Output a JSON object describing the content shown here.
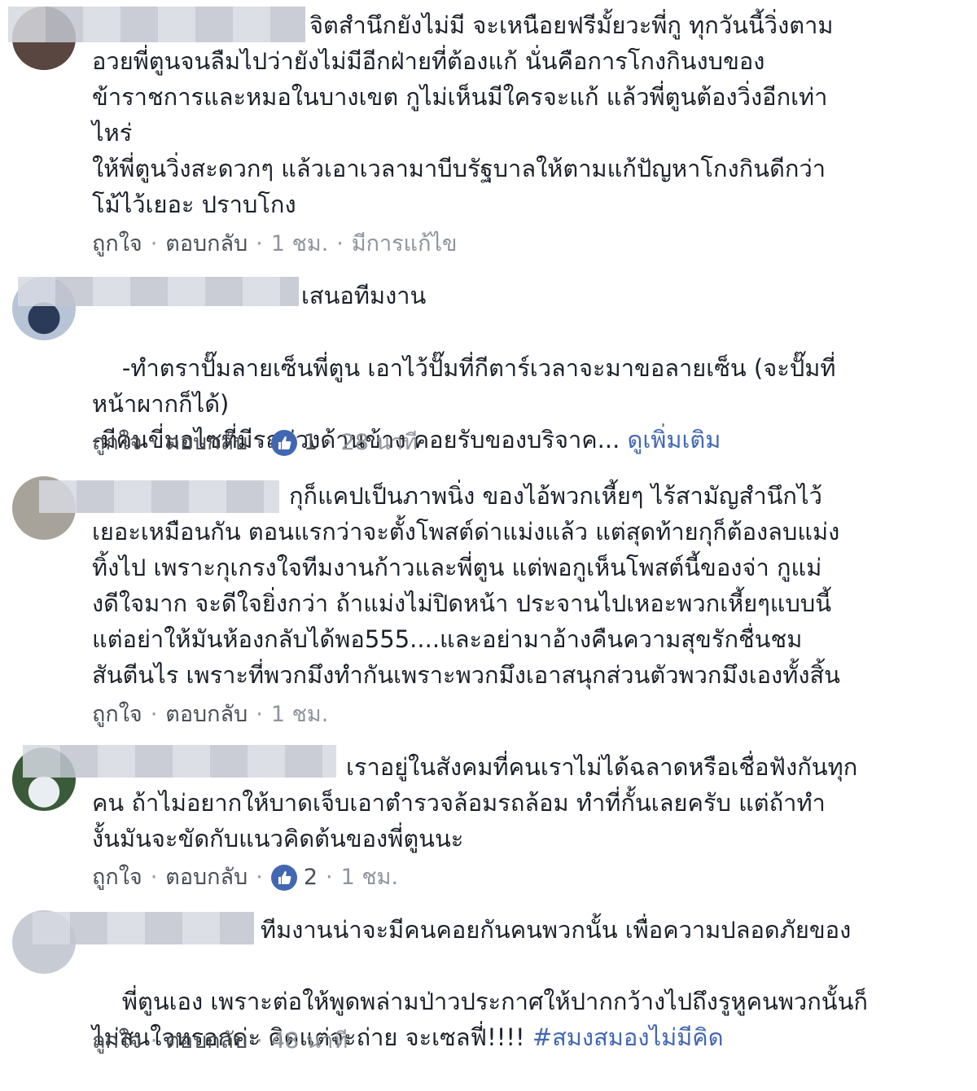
{
  "comments": [
    {
      "first_line": "จิตสำนึกยังไม่มี จะเหนือยฟรีมั้ยวะพี่กู ทุกวันนี้วิ่งตาม",
      "body": "อวยพี่ตูนจนลืมไปว่ายังไม่มีอีกฝ่ายที่ต้องแก้ นั่นคือการโกงกินงบของ\nข้าราชการและหมอในบางเขต กูไม่เห็นมีใครจะแก้ แล้วพี่ตูนต้องวิ่งอีกเท่า\nไหร่\nให้พี่ตูนวิ่งสะดวกๆ แล้วเอาเวลามาบีบรัฐบาลให้ตามแก้ปัญหาโกงกินดีกว่า\nโม้ไว้เยอะ ปราบโกง",
      "like": "ถูกใจ",
      "reply": "ตอบกลับ",
      "reactions": "",
      "time": "1 ชม.",
      "edited": "มีการแก้ไข"
    },
    {
      "first_line": "เสนอทีมงาน",
      "body": "-ทำตราปั๊มลายเซ็นพี่ตูน เอาไว้ปั๊มที่กีตาร์เวลาจะมาขอลายเซ็น (จะปั๊มที่\nหน้าผากก็ได้)\n-มีคนขี่มอไซที่มีรถพ่วงด้านข้าง คอยรับของบริจาค... ",
      "see_more": "ดูเพิ่มเติม",
      "like": "ถูกใจ",
      "reply": "ตอบกลับ",
      "reactions": "1",
      "time": "28 นาที"
    },
    {
      "first_line": "กุก็แคปเป็นภาพนิ่ง ของไอ้พวกเหี้ยๆ ไร้สามัญสำนึกไว้",
      "body": "เยอะเหมือนกัน ตอนแรกว่าจะตั้งโพสต์ด่าแม่งแล้ว แต่สุดท้ายกุก็ต้องลบแม่ง\nทิ้งไป เพราะกุเกรงใจทีมงานก้าวและพี่ตูน แต่พอกูเห็นโพสต์นี้ของจ่า กูแม่\nงดีใจมาก จะดีใจยิ่งกว่า ถ้าแม่งไม่ปิดหน้า ประจานไปเหอะพวกเหี้ยๆแบบนี้\nแต่อย่าให้มันห้องกลับได้พอ555....และอย่ามาอ้างคืนความสุขรักชื่นชม\nสันตีนไร เพราะที่พวกมึงทำกันเพราะพวกมึงเอาสนุกส่วนตัวพวกมึงเองทั้งสิ้น",
      "like": "ถูกใจ",
      "reply": "ตอบกลับ",
      "reactions": "",
      "time": "1 ชม."
    },
    {
      "first_line": "เราอยู่ในสังคมที่คนเราไม่ได้ฉลาดหรือเชื่อฟังกันทุก",
      "body": "คน ถ้าไม่อยากให้บาดเจ็บเอาตำรวจล้อมรถล้อม ทำที่กั้นเลยครับ แต่ถ้าทำ\nงั้นมันจะขัดกับแนวคิดต้นของพี่ตูนนะ",
      "like": "ถูกใจ",
      "reply": "ตอบกลับ",
      "reactions": "2",
      "time": "1 ชม."
    },
    {
      "first_line": "ทีมงานน่าจะมีคนคอยกันคนพวกนั้น เพื่อความปลอดภัยของ",
      "body": "พี่ตูนเอง เพราะต่อให้พูดพล่ามป่าวประกาศให้ปากกว้างไปถึงรูหูคนพวกนั้นก็\nไม่สนใจหรอกค่ะ คิดแต่จะถ่าย จะเซลฟี่!!!! ",
      "hashtag": "#สมงสมองไม่มีคิด",
      "like": "ถูกใจ",
      "reply": "ตอบกลับ",
      "reactions": "",
      "time": "48 นาที"
    }
  ],
  "colors": {
    "link": "#4267b2",
    "meta": "#90949c",
    "text": "#1d2129",
    "blur": "#c9cdd8"
  }
}
